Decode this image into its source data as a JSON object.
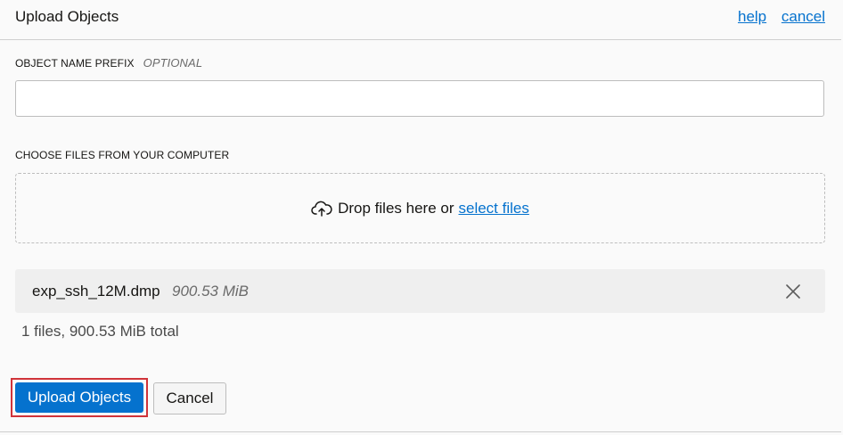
{
  "header": {
    "title": "Upload Objects",
    "help_label": "help",
    "cancel_label": "cancel"
  },
  "prefix": {
    "label": "OBJECT NAME PREFIX",
    "optional_label": "OPTIONAL",
    "value": ""
  },
  "files": {
    "label": "CHOOSE FILES FROM YOUR COMPUTER",
    "drop_text": "Drop files here or",
    "select_label": "select files",
    "icon": "cloud-upload-icon",
    "items": [
      {
        "name": "exp_ssh_12M.dmp",
        "size": "900.53 MiB"
      }
    ],
    "summary": "1 files, 900.53 MiB total"
  },
  "footer": {
    "upload_label": "Upload Objects",
    "cancel_label": "Cancel"
  },
  "colors": {
    "accent": "#0572ce",
    "highlight": "#d0343a"
  }
}
